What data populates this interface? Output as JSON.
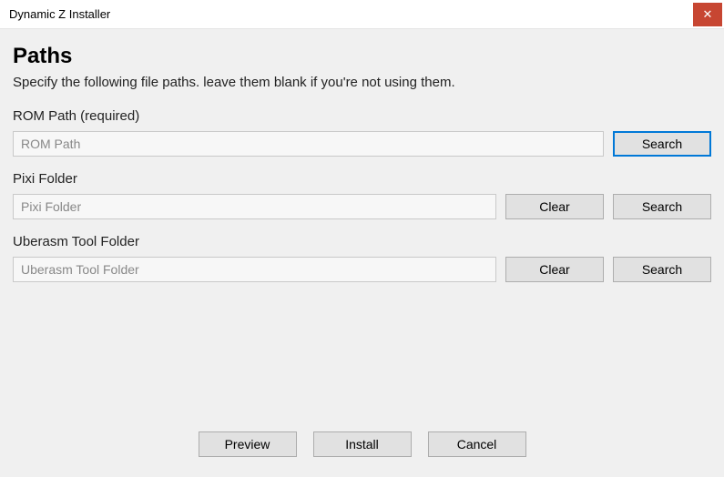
{
  "window": {
    "title": "Dynamic Z Installer",
    "close_glyph": "✕"
  },
  "page": {
    "heading": "Paths",
    "description": "Specify the following file paths. leave them blank if you're not using them."
  },
  "fields": {
    "rom": {
      "label": "ROM Path (required)",
      "placeholder": "ROM Path",
      "value": "",
      "search_label": "Search"
    },
    "pixi": {
      "label": "Pixi Folder",
      "placeholder": "Pixi Folder",
      "value": "",
      "clear_label": "Clear",
      "search_label": "Search"
    },
    "uberasm": {
      "label": "Uberasm Tool Folder",
      "placeholder": "Uberasm Tool Folder",
      "value": "",
      "clear_label": "Clear",
      "search_label": "Search"
    }
  },
  "footer": {
    "preview": "Preview",
    "install": "Install",
    "cancel": "Cancel"
  }
}
